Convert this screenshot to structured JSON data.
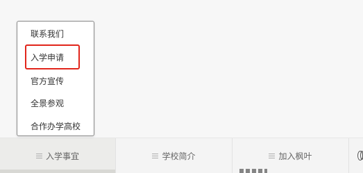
{
  "popup_menu": {
    "items": [
      {
        "label": "联系我们"
      },
      {
        "label": "入学申请"
      },
      {
        "label": "官方宣传"
      },
      {
        "label": "全景参观"
      },
      {
        "label": "合作办学高校"
      }
    ],
    "highlighted_item": "入学申请",
    "highlight_color": "#e1251b"
  },
  "bottom_nav": {
    "tabs": [
      {
        "label": "入学事宜",
        "icon": "menu-lines-icon"
      },
      {
        "label": "学校简介",
        "icon": "menu-lines-icon"
      },
      {
        "label": "加入枫叶",
        "icon": "menu-lines-icon"
      },
      {
        "label": "",
        "icon": "globe-icon"
      }
    ]
  }
}
